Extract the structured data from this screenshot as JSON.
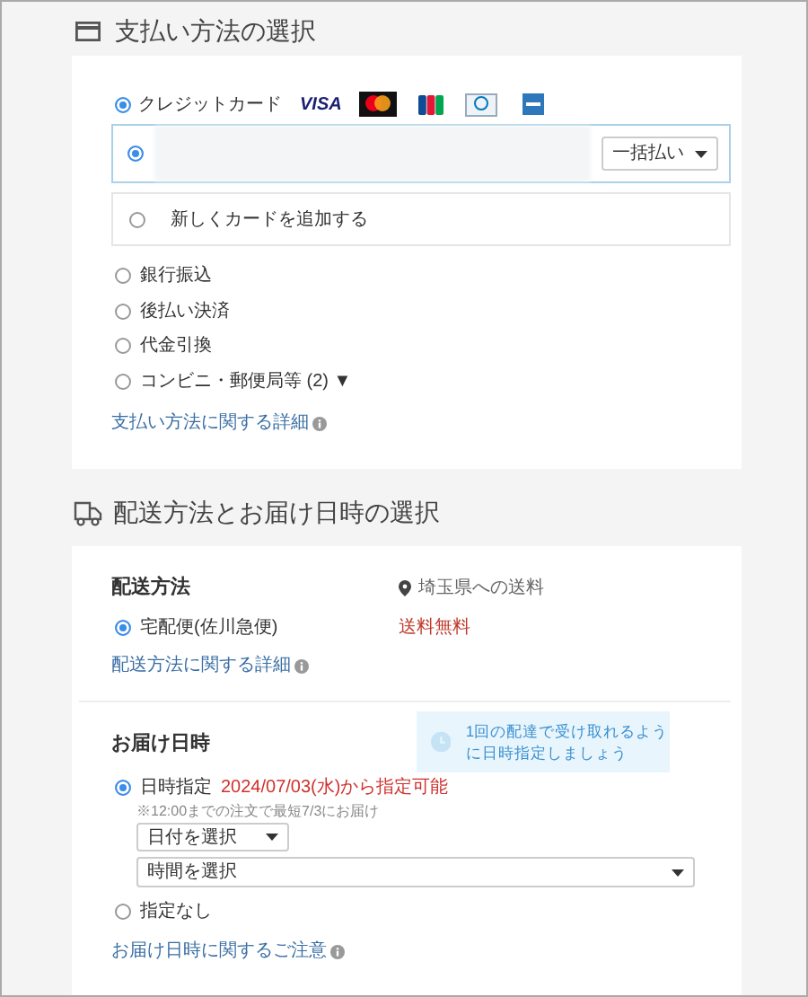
{
  "payment": {
    "title": "支払い方法の選択",
    "credit": {
      "label": "クレジットカード",
      "selected": true,
      "brand_text": "VISA"
    },
    "saved_card": {
      "selected": true,
      "installment": "一括払い"
    },
    "new_card": {
      "label": "新しくカードを追加する",
      "selected": false
    },
    "methods": [
      {
        "label": "銀行振込",
        "selected": false
      },
      {
        "label": "後払い決済",
        "selected": false
      },
      {
        "label": "代金引換",
        "selected": false
      },
      {
        "label": "コンビニ・郵便局等 (2) ▼",
        "selected": false
      }
    ],
    "details_link": "支払い方法に関する詳細"
  },
  "shipping": {
    "title": "配送方法とお届け日時の選択",
    "method_heading": "配送方法",
    "destination_note": "埼玉県への送料",
    "options": [
      {
        "label": "宅配便(佐川急便)",
        "selected": true,
        "fee": "送料無料"
      }
    ],
    "details_link": "配送方法に関する詳細",
    "delivery": {
      "heading": "お届け日時",
      "tip": "1回の配達で受け取れるように日時指定しましょう",
      "specify": {
        "label": "日時指定",
        "available": "2024/07/03(水)から指定可能",
        "selected": true,
        "note": "※12:00までの注文で最短7/3にお届け",
        "date_select": "日付を選択",
        "time_select": "時間を選択"
      },
      "none": {
        "label": "指定なし",
        "selected": false
      },
      "notes_link": "お届け日時に関するご注意"
    }
  }
}
